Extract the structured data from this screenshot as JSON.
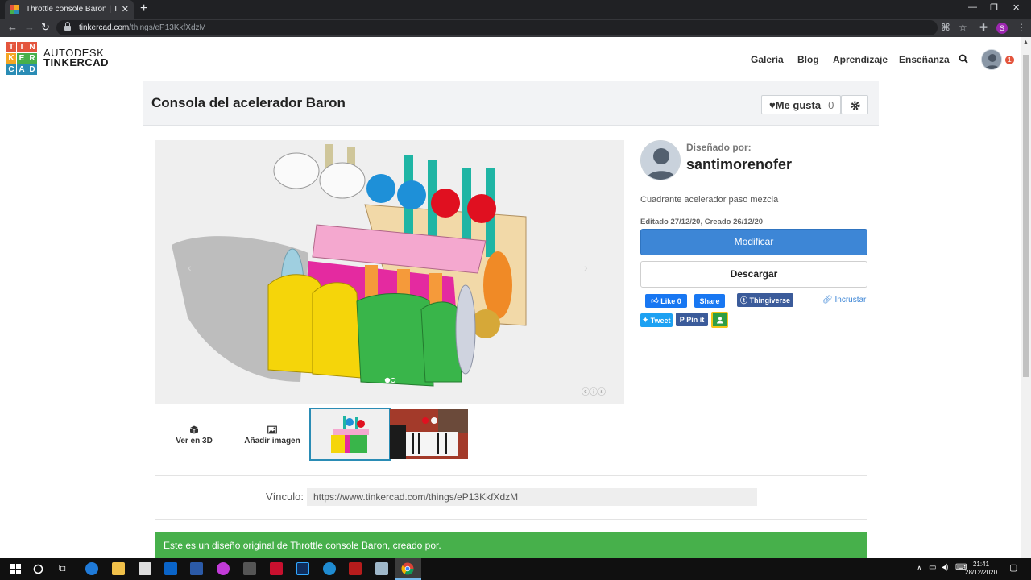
{
  "browser": {
    "tab_title": "Throttle console Baron | Tinkerca",
    "url_host": "tinkercad.com",
    "url_path": "/things/eP13KkfXdzM",
    "profile_initial": "S"
  },
  "site": {
    "logo_letters": [
      "T",
      "I",
      "N",
      "K",
      "E",
      "R",
      "C",
      "A",
      "D"
    ],
    "brand_line1": "AUTODESK",
    "brand_line2": "TINKERCAD",
    "nav": [
      "Galería",
      "Blog",
      "Aprendizaje",
      "Enseñanza"
    ],
    "notifications": "1"
  },
  "design": {
    "title": "Consola del acelerador Baron",
    "like_label": "Me gusta",
    "like_count": "0",
    "designed_by_label": "Diseñado por:",
    "designer": "santimorenofer",
    "description": "Cuadrante acelerador paso mezcla",
    "dates": "Editado 27/12/20, Creado 26/12/20",
    "modify_label": "Modificar",
    "download_label": "Descargar",
    "view3d_label": "Ver en 3D",
    "add_image_label": "Añadir imagen",
    "link_label": "Vínculo:",
    "link_value": "https://www.tinkercad.com/things/eP13KkfXdzM",
    "banner": "Este es un diseño original de Throttle console Baron, creado por.",
    "cc_badge": "ⓒⓘⓢ"
  },
  "social": {
    "like": "Like 0",
    "share": "Share",
    "thingiverse": "Thingiverse",
    "embed": "Incrustar",
    "tweet": "Tweet",
    "pin": "Pin it"
  },
  "taskbar": {
    "time": "21:41",
    "date": "28/12/2020"
  },
  "colors": {
    "accent": "#3d86d6",
    "banner": "#47b04b",
    "facebook": "#1877f2",
    "twitter": "#1da1f2",
    "pinterest": "#3b5b9a"
  }
}
